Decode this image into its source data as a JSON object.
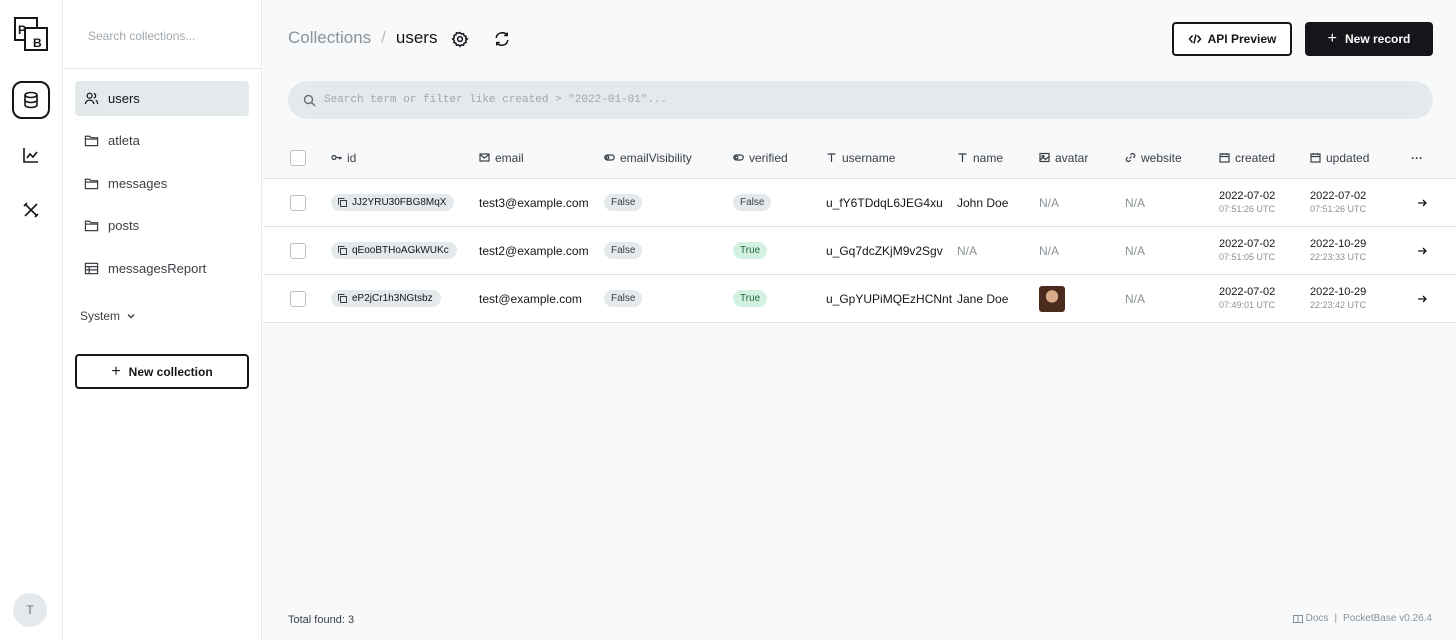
{
  "app": {
    "logo_letters": "PB",
    "user_initial": "T"
  },
  "sidebar": {
    "search_placeholder": "Search collections...",
    "items": [
      {
        "label": "users",
        "icon": "users-icon"
      },
      {
        "label": "atleta",
        "icon": "folder-icon"
      },
      {
        "label": "messages",
        "icon": "folder-icon"
      },
      {
        "label": "posts",
        "icon": "folder-icon"
      },
      {
        "label": "messagesReport",
        "icon": "table-icon"
      }
    ],
    "system_label": "System",
    "new_collection_label": "New collection"
  },
  "header": {
    "breadcrumb_parent": "Collections",
    "breadcrumb_sep": "/",
    "breadcrumb_current": "users",
    "api_preview_label": "API Preview",
    "new_record_label": "New record"
  },
  "filter": {
    "placeholder": "Search term or filter like created > \"2022-01-01\"..."
  },
  "table": {
    "columns": [
      "id",
      "email",
      "emailVisibility",
      "verified",
      "username",
      "name",
      "avatar",
      "website",
      "created",
      "updated"
    ],
    "more_label": "···",
    "rows": [
      {
        "id": "JJ2YRU30FBG8MqX",
        "email": "test3@example.com",
        "emailVisibility": "False",
        "verified": "False",
        "username": "u_fY6TDdqL6JEG4xu",
        "name": "John Doe",
        "avatar": "N/A",
        "website": "N/A",
        "created_date": "2022-07-02",
        "created_time": "07:51:26 UTC",
        "updated_date": "2022-07-02",
        "updated_time": "07:51:26 UTC"
      },
      {
        "id": "qEooBTHoAGkWUKc",
        "email": "test2@example.com",
        "emailVisibility": "False",
        "verified": "True",
        "username": "u_Gq7dcZKjM9v2Sgv",
        "name": "N/A",
        "avatar": "N/A",
        "website": "N/A",
        "created_date": "2022-07-02",
        "created_time": "07:51:05 UTC",
        "updated_date": "2022-10-29",
        "updated_time": "22:23:33 UTC"
      },
      {
        "id": "eP2jCr1h3NGtsbz",
        "email": "test@example.com",
        "emailVisibility": "False",
        "verified": "True",
        "username": "u_GpYUPiMQEzHCNnt",
        "name": "Jane Doe",
        "avatar": "image",
        "website": "N/A",
        "created_date": "2022-07-02",
        "created_time": "07:49:01 UTC",
        "updated_date": "2022-10-29",
        "updated_time": "22:23:42 UTC"
      }
    ]
  },
  "footer": {
    "total_label": "Total found:",
    "total_value": "3",
    "docs_label": "Docs",
    "sep": "|",
    "version": "PocketBase v0.26.4"
  }
}
